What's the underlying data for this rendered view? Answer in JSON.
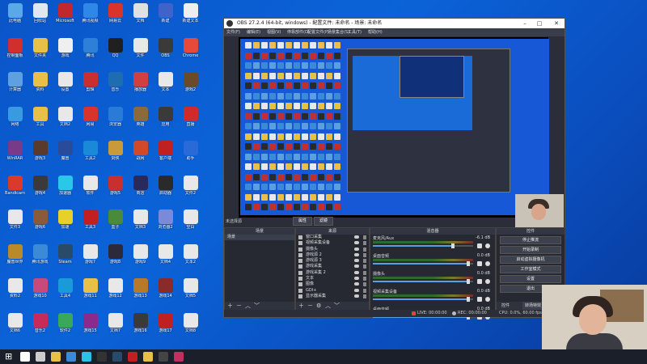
{
  "desktop": {
    "icons": [
      {
        "label": "此电脑",
        "color": "#5aa8e8"
      },
      {
        "label": "回收站",
        "color": "#dfe7ef"
      },
      {
        "label": "Microsoft",
        "color": "#c0282d"
      },
      {
        "label": "腾讯视频",
        "color": "#2f88e8"
      },
      {
        "label": "网易云",
        "color": "#d9342b"
      },
      {
        "label": "文档",
        "color": "#e0e0e0"
      },
      {
        "label": "新建",
        "color": "#3e63c9"
      },
      {
        "label": "新建文本",
        "color": "#eeeeee"
      },
      {
        "label": "控制面板",
        "color": "#d12e2e"
      },
      {
        "label": "文件夹",
        "color": "#e8c048"
      },
      {
        "label": "游戏",
        "color": "#efefef"
      },
      {
        "label": "腾讯",
        "color": "#2e7fd8"
      },
      {
        "label": "QQ",
        "color": "#202020"
      },
      {
        "label": "文件",
        "color": "#e8e8e8"
      },
      {
        "label": "OBS",
        "color": "#3a3a3a"
      },
      {
        "label": "Chrome",
        "color": "#e84a3a"
      },
      {
        "label": "计算器",
        "color": "#5fa0e0"
      },
      {
        "label": "资料",
        "color": "#e8c048"
      },
      {
        "label": "设置",
        "color": "#e8e8e8"
      },
      {
        "label": "剪辑",
        "color": "#c82f2f"
      },
      {
        "label": "音乐",
        "color": "#1d6db0"
      },
      {
        "label": "播放器",
        "color": "#d04040"
      },
      {
        "label": "文本",
        "color": "#e8e8e8"
      },
      {
        "label": "游戏2",
        "color": "#6a4a2a"
      },
      {
        "label": "网络",
        "color": "#3a9ae0"
      },
      {
        "label": "工具",
        "color": "#e8c048"
      },
      {
        "label": "文档2",
        "color": "#e8e8e8"
      },
      {
        "label": "网易",
        "color": "#d9342b"
      },
      {
        "label": "浏览器",
        "color": "#2a7ad8"
      },
      {
        "label": "英雄",
        "color": "#8a6a3a"
      },
      {
        "label": "应用",
        "color": "#3a3a3a"
      },
      {
        "label": "直播",
        "color": "#d02a2a"
      },
      {
        "label": "WinRAR",
        "color": "#7a3a8a"
      },
      {
        "label": "游戏3",
        "color": "#5a3a2a"
      },
      {
        "label": "魔兽",
        "color": "#2a4a9a"
      },
      {
        "label": "工具2",
        "color": "#1a8ad8"
      },
      {
        "label": "剑侠",
        "color": "#c89a3a"
      },
      {
        "label": "战网",
        "color": "#d04a2a"
      },
      {
        "label": "客户端",
        "color": "#c02020"
      },
      {
        "label": "助手",
        "color": "#2a6ad8"
      },
      {
        "label": "Bandicam",
        "color": "#d93a2a"
      },
      {
        "label": "游戏4",
        "color": "#3a3a3a"
      },
      {
        "label": "加速器",
        "color": "#2ac8e8"
      },
      {
        "label": "软件",
        "color": "#e8e8e8"
      },
      {
        "label": "游戏5",
        "color": "#c82f2f"
      },
      {
        "label": "商店",
        "color": "#2a2a5a"
      },
      {
        "label": "启动器",
        "color": "#2a2a2a"
      },
      {
        "label": "文件2",
        "color": "#e8e8e8"
      },
      {
        "label": "文件3",
        "color": "#e8e8e8"
      },
      {
        "label": "游戏6",
        "color": "#8a5a3a"
      },
      {
        "label": "加速",
        "color": "#e8d02a"
      },
      {
        "label": "工具3",
        "color": "#c02020"
      },
      {
        "label": "盒子",
        "color": "#4a8a3a"
      },
      {
        "label": "文档3",
        "color": "#e8e8e8"
      },
      {
        "label": "浏览器2",
        "color": "#7a8ad8"
      },
      {
        "label": "空白",
        "color": "#e8e8e8"
      },
      {
        "label": "魔兽世界",
        "color": "#b88a2a"
      },
      {
        "label": "腾讯游戏",
        "color": "#3a8ad8"
      },
      {
        "label": "Steam",
        "color": "#2a4a6a"
      },
      {
        "label": "游戏7",
        "color": "#e8e8e8"
      },
      {
        "label": "游戏8",
        "color": "#2a2a3a"
      },
      {
        "label": "游戏9",
        "color": "#e8e8e8"
      },
      {
        "label": "文档4",
        "color": "#e8e8e8"
      },
      {
        "label": "文本2",
        "color": "#e8e8e8"
      },
      {
        "label": "资料2",
        "color": "#e8e8e8"
      },
      {
        "label": "游戏10",
        "color": "#c84a7a"
      },
      {
        "label": "工具4",
        "color": "#1a9ad8"
      },
      {
        "label": "游戏11",
        "color": "#e8c048"
      },
      {
        "label": "游戏12",
        "color": "#e8e8e8"
      },
      {
        "label": "游戏13",
        "color": "#b87a2a"
      },
      {
        "label": "游戏14",
        "color": "#8a2a2a"
      },
      {
        "label": "文档5",
        "color": "#e8e8e8"
      },
      {
        "label": "文档6",
        "color": "#e8e8e8"
      },
      {
        "label": "音乐2",
        "color": "#c82a5a"
      },
      {
        "label": "软件2",
        "color": "#3aa85a"
      },
      {
        "label": "游戏15",
        "color": "#8a2a8a"
      },
      {
        "label": "文档7",
        "color": "#e8e8e8"
      },
      {
        "label": "游戏16",
        "color": "#3a3a3a"
      },
      {
        "label": "游戏17",
        "color": "#c02020"
      },
      {
        "label": "文档8",
        "color": "#e8e8e8"
      }
    ]
  },
  "taskbar": {
    "icons": [
      "start",
      "search",
      "task-view",
      "file-explorer",
      "browser",
      "edge",
      "obs",
      "steam",
      "game",
      "folder",
      "terminal",
      "media"
    ]
  },
  "obs": {
    "title": "OBS 27.2.4 (64-bit, windows) - 配置文件: 未命名 - 场景: 未命名",
    "menu": [
      "文件(F)",
      "编辑(E)",
      "视图(V)",
      "停靠部件(D)",
      "配置文件(P)",
      "场景集合(S)",
      "工具(T)",
      "帮助(H)"
    ],
    "scene_label": "未选择源",
    "transition_buttons": [
      "属性",
      "滤镜"
    ],
    "docks": {
      "scenes": {
        "title": "场景",
        "items": [
          "场景"
        ]
      },
      "sources": {
        "title": "来源",
        "items": [
          "窗口采集",
          "视频采集设备",
          "摄像头",
          "游戏源 2",
          "游戏源 3",
          "游戏采集",
          "游戏采集 2",
          "文本",
          "图像",
          "GDI+",
          "显示器采集"
        ]
      },
      "mixer": {
        "title": "混音器",
        "channels": [
          {
            "name": "麦克风/Aux",
            "db": "-6.1 dB",
            "level": 0.8
          },
          {
            "name": "桌面音频",
            "db": "0.0 dB",
            "level": 0.95
          },
          {
            "name": "摄像头",
            "db": "0.0 dB",
            "level": 0.95
          },
          {
            "name": "视频采集设备",
            "db": "0.0 dB",
            "level": 0.95
          },
          {
            "name": "桌面音频",
            "db": "0.0 dB",
            "level": 0.95
          }
        ]
      },
      "controls": {
        "title": "控件",
        "buttons": [
          "停止推流",
          "开始录制",
          "启动虚拟摄像机",
          "工作室模式",
          "设置",
          "退出"
        ],
        "footer": [
          "控件",
          "转场特效"
        ]
      }
    },
    "status": {
      "live": "LIVE: 00:00:00",
      "rec": "REC: 00:00:00",
      "cpu": "CPU: 0.0%, 60.00 fps"
    }
  }
}
